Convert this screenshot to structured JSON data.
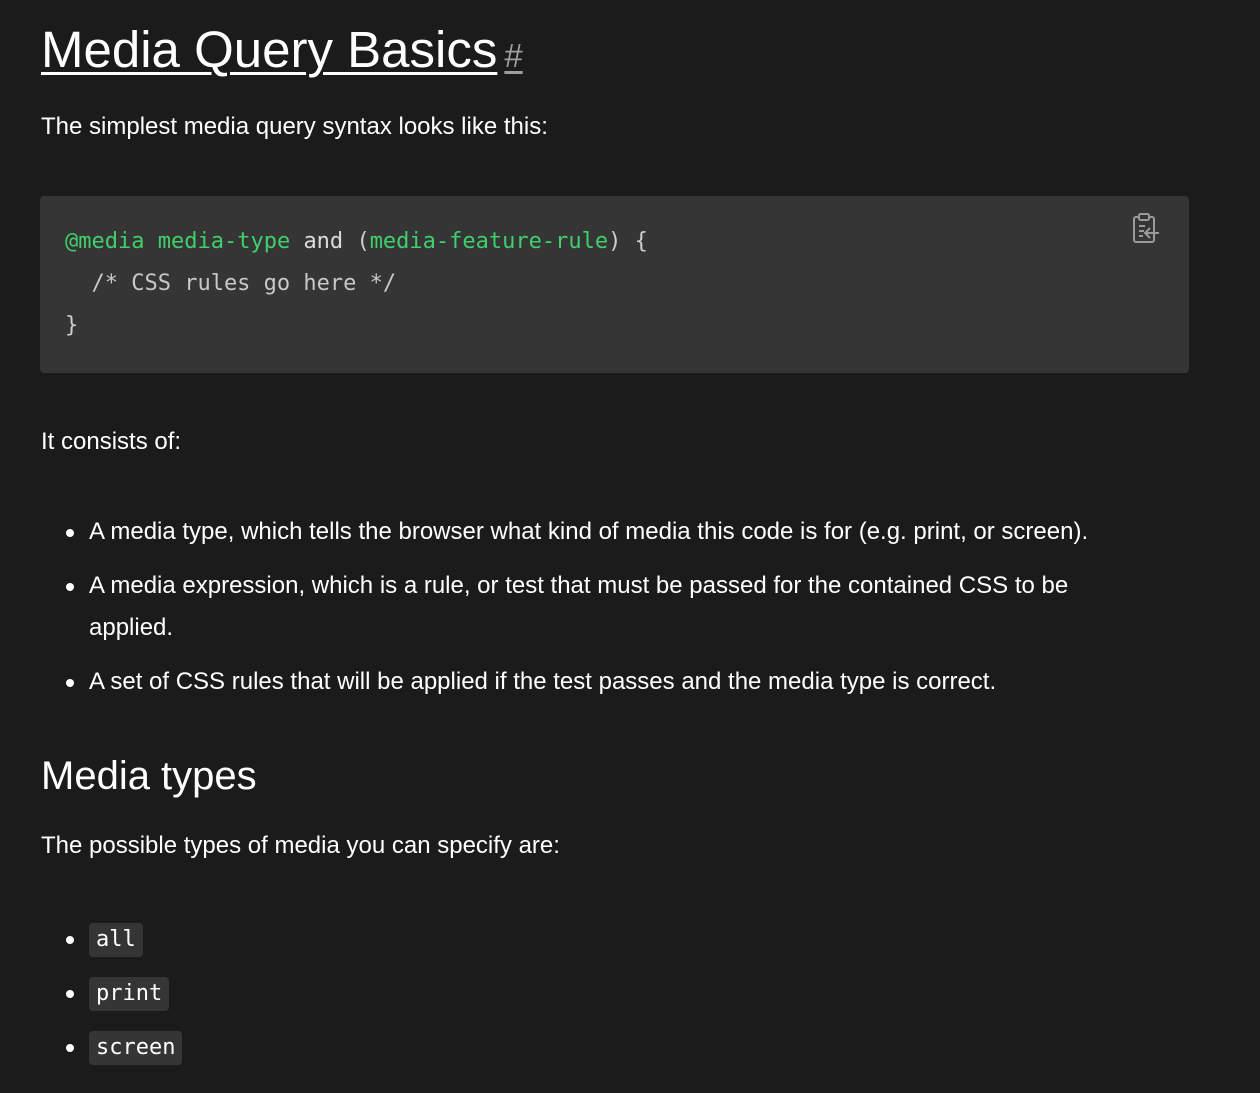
{
  "heading": {
    "title": "Media Query Basics",
    "anchor": "#"
  },
  "intro": "The simplest media query syntax looks like this:",
  "code": {
    "line1": {
      "at_rule": "@media",
      "space1": " ",
      "media_type": "media-type",
      "space2": " ",
      "keyword": "and",
      "space3": " ",
      "paren_open": "(",
      "feature": "media-feature-rule",
      "paren_close": ")",
      "brace_open": " {"
    },
    "line2": "  /* CSS rules go here */",
    "line3": "}",
    "copy_icon": "clipboard-copy-icon"
  },
  "consists_intro": "It consists of:",
  "consists_items": [
    "A media type, which tells the browser what kind of media this code is for (e.g. print, or screen).",
    "A media expression, which is a rule, or test that must be passed for the contained CSS to be applied.",
    "A set of CSS rules that will be applied if the test passes and the media type is correct."
  ],
  "media_types_section": {
    "heading": "Media types",
    "intro": "The possible types of media you can specify are:",
    "types": [
      "all",
      "print",
      "screen"
    ]
  },
  "colors": {
    "background": "#1b1b1b",
    "code_background": "#353535",
    "code_green": "#3fcf6b",
    "text": "#ffffff",
    "muted": "#9e9e9e"
  }
}
